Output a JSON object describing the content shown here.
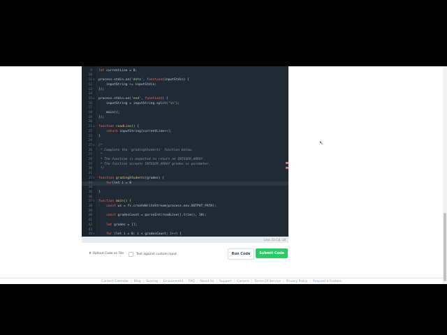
{
  "editor": {
    "lines": [
      {
        "n": "8",
        "fold": "",
        "html": ""
      },
      {
        "n": "9",
        "fold": "",
        "parts": [
          [
            "kw",
            "let "
          ],
          [
            "",
            "currentLine = 0;"
          ]
        ]
      },
      {
        "n": "10",
        "fold": "",
        "parts": []
      },
      {
        "n": "11",
        "fold": "v",
        "parts": [
          [
            "",
            "process.stdin.on("
          ],
          [
            "str",
            "'data'"
          ],
          [
            "",
            ", "
          ],
          [
            "kw",
            "function"
          ],
          [
            "",
            "(inputStdin) {"
          ]
        ]
      },
      {
        "n": "12",
        "fold": "",
        "parts": [
          [
            "",
            "    inputString += inputStdin;"
          ]
        ]
      },
      {
        "n": "13",
        "fold": "",
        "parts": [
          [
            "",
            "});"
          ]
        ]
      },
      {
        "n": "14",
        "fold": "",
        "parts": []
      },
      {
        "n": "15",
        "fold": "v",
        "parts": [
          [
            "",
            "process.stdin.on("
          ],
          [
            "str",
            "'end'"
          ],
          [
            "",
            ", "
          ],
          [
            "kw",
            "function"
          ],
          [
            "",
            "() {"
          ]
        ]
      },
      {
        "n": "16",
        "fold": "",
        "parts": [
          [
            "",
            "    inputString = inputString.split("
          ],
          [
            "str",
            "'\\n'"
          ],
          [
            "",
            ");"
          ]
        ]
      },
      {
        "n": "17",
        "fold": "",
        "parts": []
      },
      {
        "n": "18",
        "fold": "",
        "parts": [
          [
            "",
            "    main();"
          ]
        ]
      },
      {
        "n": "19",
        "fold": "",
        "parts": [
          [
            "",
            "});"
          ]
        ]
      },
      {
        "n": "20",
        "fold": "",
        "parts": []
      },
      {
        "n": "21",
        "fold": "v",
        "parts": [
          [
            "kw",
            "function "
          ],
          [
            "fn",
            "readLine"
          ],
          [
            "",
            "() {"
          ]
        ]
      },
      {
        "n": "22",
        "fold": "",
        "parts": [
          [
            "kw",
            "    return "
          ],
          [
            "",
            "inputString[currentLine++];"
          ]
        ]
      },
      {
        "n": "23",
        "fold": "",
        "parts": [
          [
            "",
            "}"
          ]
        ]
      },
      {
        "n": "24",
        "fold": "",
        "parts": []
      },
      {
        "n": "25",
        "fold": "v",
        "parts": [
          [
            "cm",
            "/*"
          ]
        ]
      },
      {
        "n": "26",
        "fold": "",
        "parts": [
          [
            "cm",
            " * Complete the 'gradingStudents' function below."
          ]
        ]
      },
      {
        "n": "27",
        "fold": "",
        "parts": [
          [
            "cm",
            " *"
          ]
        ]
      },
      {
        "n": "28",
        "fold": "",
        "parts": [
          [
            "cm",
            " * The function is expected to return an INTEGER_ARRAY."
          ]
        ]
      },
      {
        "n": "29",
        "fold": "",
        "parts": [
          [
            "cm",
            " * The function accepts INTEGER_ARRAY grades as parameter."
          ]
        ]
      },
      {
        "n": "30",
        "fold": "",
        "parts": [
          [
            "cm",
            " */"
          ]
        ]
      },
      {
        "n": "31",
        "fold": "",
        "parts": []
      },
      {
        "n": "32",
        "fold": "v",
        "parts": [
          [
            "kw",
            "function "
          ],
          [
            "fn",
            "gradingStudents"
          ],
          [
            "",
            "(grades) {"
          ]
        ]
      },
      {
        "n": "33",
        "fold": "",
        "hl": true,
        "parts": [
          [
            "",
            "    "
          ],
          [
            "kw",
            "for"
          ],
          [
            "",
            "(let i = 0"
          ]
        ]
      },
      {
        "n": "34",
        "fold": "",
        "parts": []
      },
      {
        "n": "35",
        "fold": "",
        "parts": [
          [
            "",
            "}"
          ]
        ]
      },
      {
        "n": "36",
        "fold": "",
        "parts": []
      },
      {
        "n": "37",
        "fold": "v",
        "parts": [
          [
            "kw",
            "function "
          ],
          [
            "fn",
            "main"
          ],
          [
            "",
            "() {"
          ]
        ]
      },
      {
        "n": "38",
        "fold": "",
        "parts": [
          [
            "kw",
            "    const "
          ],
          [
            "",
            "ws = fs.createWriteStream(process.env.OUTPUT_PATH);"
          ]
        ]
      },
      {
        "n": "39",
        "fold": "",
        "parts": []
      },
      {
        "n": "40",
        "fold": "",
        "parts": [
          [
            "kw",
            "    const "
          ],
          [
            "",
            "gradesCount = parseInt(readLine().trim(), 10);"
          ]
        ]
      },
      {
        "n": "41",
        "fold": "",
        "parts": []
      },
      {
        "n": "42",
        "fold": "",
        "parts": [
          [
            "kw",
            "    let "
          ],
          [
            "",
            "grades = [];"
          ]
        ]
      },
      {
        "n": "43",
        "fold": "",
        "parts": []
      },
      {
        "n": "44",
        "fold": "v",
        "parts": [
          [
            "kw",
            "    for "
          ],
          [
            "",
            "(let i = 0; i < gradesCount; i++) {"
          ]
        ]
      }
    ]
  },
  "status": "Line: 33 Col: 18",
  "upload_label": "Upload Code as File",
  "custom_input_label": "Test against custom input",
  "run_button": "Run Code",
  "submit_button": "Submit Code",
  "footer_links": [
    "Contest Calendar",
    "Blog",
    "Scoring",
    "Environment",
    "FAQ",
    "About Us",
    "Support",
    "Careers",
    "Terms Of Service",
    "Privacy Policy",
    "Request a Feature"
  ],
  "colors": {
    "submit": "#2ec866",
    "editor_bg": "#1f2a34"
  }
}
